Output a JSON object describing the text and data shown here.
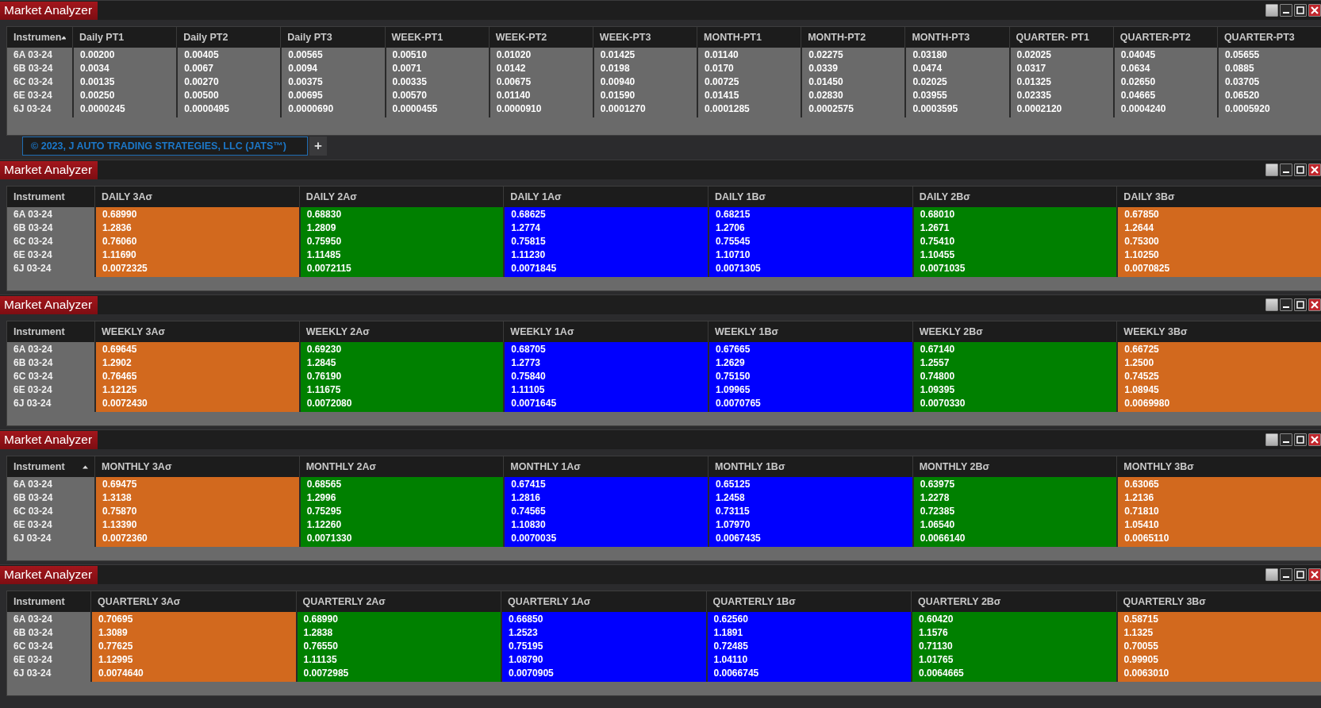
{
  "windows": [
    {
      "title": "Market Analyzer",
      "sorted_by_instrument": true,
      "columns": [
        {
          "label": "Instrumen"
        },
        {
          "label": "Daily PT1"
        },
        {
          "label": "Daily PT2"
        },
        {
          "label": "Daily PT3"
        },
        {
          "label": "WEEK-PT1"
        },
        {
          "label": "WEEK-PT2"
        },
        {
          "label": "WEEK-PT3"
        },
        {
          "label": "MONTH-PT1"
        },
        {
          "label": "MONTH-PT2"
        },
        {
          "label": "MONTH-PT3"
        },
        {
          "label": "QUARTER- PT1"
        },
        {
          "label": "QUARTER-PT2"
        },
        {
          "label": "QUARTER-PT3"
        }
      ],
      "rows": [
        [
          "6A 03-24",
          "0.00200",
          "0.00405",
          "0.00565",
          "0.00510",
          "0.01020",
          "0.01425",
          "0.01140",
          "0.02275",
          "0.03180",
          "0.02025",
          "0.04045",
          "0.05655"
        ],
        [
          "6B 03-24",
          "0.0034",
          "0.0067",
          "0.0094",
          "0.0071",
          "0.0142",
          "0.0198",
          "0.0170",
          "0.0339",
          "0.0474",
          "0.0317",
          "0.0634",
          "0.0885"
        ],
        [
          "6C 03-24",
          "0.00135",
          "0.00270",
          "0.00375",
          "0.00335",
          "0.00675",
          "0.00940",
          "0.00725",
          "0.01450",
          "0.02025",
          "0.01325",
          "0.02650",
          "0.03705"
        ],
        [
          "6E 03-24",
          "0.00250",
          "0.00500",
          "0.00695",
          "0.00570",
          "0.01140",
          "0.01590",
          "0.01415",
          "0.02830",
          "0.03955",
          "0.02335",
          "0.04665",
          "0.06520"
        ],
        [
          "6J 03-24",
          "0.0000245",
          "0.0000495",
          "0.0000690",
          "0.0000455",
          "0.0000910",
          "0.0001270",
          "0.0001285",
          "0.0002575",
          "0.0003595",
          "0.0002120",
          "0.0004240",
          "0.0005920"
        ]
      ],
      "tabs": [
        {
          "label": "© 2023, J AUTO TRADING STRATEGIES, LLC (JATS™)",
          "selected": true
        }
      ],
      "add_tab": "+"
    },
    {
      "title": "Market Analyzer",
      "sorted_by_instrument": false,
      "columns": [
        {
          "label": "Instrument"
        },
        {
          "label": "DAILY 3Aσ",
          "color": "#d2691e"
        },
        {
          "label": "DAILY 2Aσ",
          "color": "#008000"
        },
        {
          "label": "DAILY 1Aσ",
          "color": "#0000ff"
        },
        {
          "label": "DAILY 1Bσ",
          "color": "#0000ff"
        },
        {
          "label": "DAILY 2Bσ",
          "color": "#008000"
        },
        {
          "label": "DAILY 3Bσ",
          "color": "#d2691e"
        }
      ],
      "rows": [
        [
          "6A 03-24",
          "0.68990",
          "0.68830",
          "0.68625",
          "0.68215",
          "0.68010",
          "0.67850"
        ],
        [
          "6B 03-24",
          "1.2836",
          "1.2809",
          "1.2774",
          "1.2706",
          "1.2671",
          "1.2644"
        ],
        [
          "6C 03-24",
          "0.76060",
          "0.75950",
          "0.75815",
          "0.75545",
          "0.75410",
          "0.75300"
        ],
        [
          "6E 03-24",
          "1.11690",
          "1.11485",
          "1.11230",
          "1.10710",
          "1.10455",
          "1.10250"
        ],
        [
          "6J 03-24",
          "0.0072325",
          "0.0072115",
          "0.0071845",
          "0.0071305",
          "0.0071035",
          "0.0070825"
        ]
      ]
    },
    {
      "title": "Market Analyzer",
      "sorted_by_instrument": false,
      "columns": [
        {
          "label": "Instrument"
        },
        {
          "label": "WEEKLY 3Aσ",
          "color": "#d2691e"
        },
        {
          "label": "WEEKLY 2Aσ",
          "color": "#008000"
        },
        {
          "label": "WEEKLY 1Aσ",
          "color": "#0000ff"
        },
        {
          "label": "WEEKLY 1Bσ",
          "color": "#0000ff"
        },
        {
          "label": "WEEKLY 2Bσ",
          "color": "#008000"
        },
        {
          "label": "WEEKLY 3Bσ",
          "color": "#d2691e"
        }
      ],
      "rows": [
        [
          "6A 03-24",
          "0.69645",
          "0.69230",
          "0.68705",
          "0.67665",
          "0.67140",
          "0.66725"
        ],
        [
          "6B 03-24",
          "1.2902",
          "1.2845",
          "1.2773",
          "1.2629",
          "1.2557",
          "1.2500"
        ],
        [
          "6C 03-24",
          "0.76465",
          "0.76190",
          "0.75840",
          "0.75150",
          "0.74800",
          "0.74525"
        ],
        [
          "6E 03-24",
          "1.12125",
          "1.11675",
          "1.11105",
          "1.09965",
          "1.09395",
          "1.08945"
        ],
        [
          "6J 03-24",
          "0.0072430",
          "0.0072080",
          "0.0071645",
          "0.0070765",
          "0.0070330",
          "0.0069980"
        ]
      ]
    },
    {
      "title": "Market Analyzer",
      "sorted_by_instrument": true,
      "columns": [
        {
          "label": "Instrument"
        },
        {
          "label": "MONTHLY 3Aσ",
          "color": "#d2691e"
        },
        {
          "label": "MONTHLY 2Aσ",
          "color": "#008000"
        },
        {
          "label": "MONTHLY 1Aσ",
          "color": "#0000ff"
        },
        {
          "label": "MONTHLY 1Bσ",
          "color": "#0000ff"
        },
        {
          "label": "MONTHLY 2Bσ",
          "color": "#008000"
        },
        {
          "label": "MONTHLY 3Bσ",
          "color": "#d2691e"
        }
      ],
      "rows": [
        [
          "6A 03-24",
          "0.69475",
          "0.68565",
          "0.67415",
          "0.65125",
          "0.63975",
          "0.63065"
        ],
        [
          "6B 03-24",
          "1.3138",
          "1.2996",
          "1.2816",
          "1.2458",
          "1.2278",
          "1.2136"
        ],
        [
          "6C 03-24",
          "0.75870",
          "0.75295",
          "0.74565",
          "0.73115",
          "0.72385",
          "0.71810"
        ],
        [
          "6E 03-24",
          "1.13390",
          "1.12260",
          "1.10830",
          "1.07970",
          "1.06540",
          "1.05410"
        ],
        [
          "6J 03-24",
          "0.0072360",
          "0.0071330",
          "0.0070035",
          "0.0067435",
          "0.0066140",
          "0.0065110"
        ]
      ]
    },
    {
      "title": "Market Analyzer",
      "sorted_by_instrument": false,
      "columns": [
        {
          "label": "Instrument"
        },
        {
          "label": "QUARTERLY 3Aσ",
          "color": "#d2691e"
        },
        {
          "label": "QUARTERLY 2Aσ",
          "color": "#008000"
        },
        {
          "label": "QUARTERLY 1Aσ",
          "color": "#0000ff"
        },
        {
          "label": "QUARTERLY 1Bσ",
          "color": "#0000ff"
        },
        {
          "label": "QUARTERLY 2Bσ",
          "color": "#008000"
        },
        {
          "label": "QUARTERLY 3Bσ",
          "color": "#d2691e"
        }
      ],
      "rows": [
        [
          "6A 03-24",
          "0.70695",
          "0.68990",
          "0.66850",
          "0.62560",
          "0.60420",
          "0.58715"
        ],
        [
          "6B 03-24",
          "1.3089",
          "1.2838",
          "1.2523",
          "1.1891",
          "1.1576",
          "1.1325"
        ],
        [
          "6C 03-24",
          "0.77625",
          "0.76550",
          "0.75195",
          "0.72485",
          "0.71130",
          "0.70055"
        ],
        [
          "6E 03-24",
          "1.12995",
          "1.11135",
          "1.08790",
          "1.04110",
          "1.01765",
          "0.99905"
        ],
        [
          "6J 03-24",
          "0.0074640",
          "0.0072985",
          "0.0070905",
          "0.0066745",
          "0.0064665",
          "0.0063010"
        ]
      ]
    }
  ]
}
